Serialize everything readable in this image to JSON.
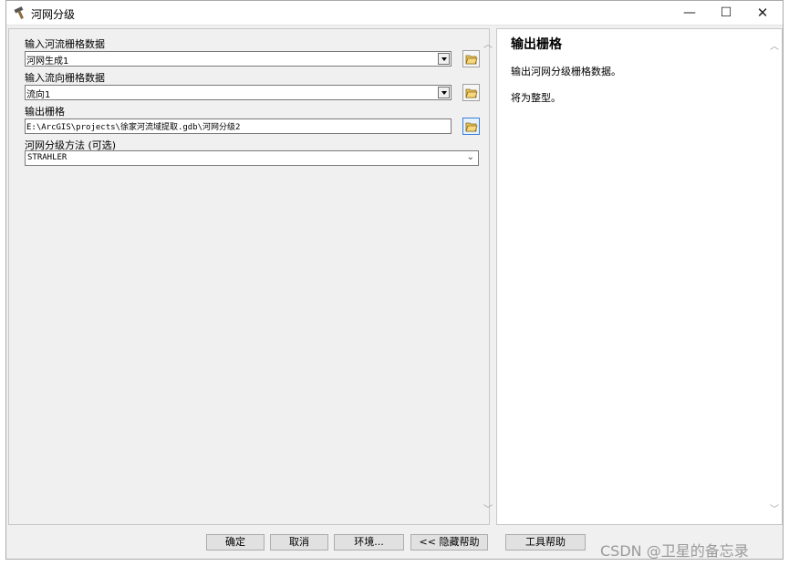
{
  "window": {
    "title": "河网分级"
  },
  "form": {
    "input_stream_label": "输入河流栅格数据",
    "input_stream_value": "河网生成1",
    "input_flowdir_label": "输入流向栅格数据",
    "input_flowdir_value": "流向1",
    "output_label": "输出栅格",
    "output_value": "E:\\ArcGIS\\projects\\徐家河流域提取.gdb\\河网分级2",
    "method_label": "河网分级方法 (可选)",
    "method_value": "STRAHLER"
  },
  "help": {
    "title": "输出栅格",
    "p1": "输出河网分级栅格数据。",
    "p2": "将为整型。"
  },
  "buttons": {
    "ok": "确定",
    "cancel": "取消",
    "env": "环境...",
    "hide_help": "<< 隐藏帮助",
    "tool_help": "工具帮助"
  },
  "watermark": "CSDN @卫星的备忘录",
  "icons": {
    "app": "hammer-icon",
    "browse": "folder-open-icon"
  }
}
